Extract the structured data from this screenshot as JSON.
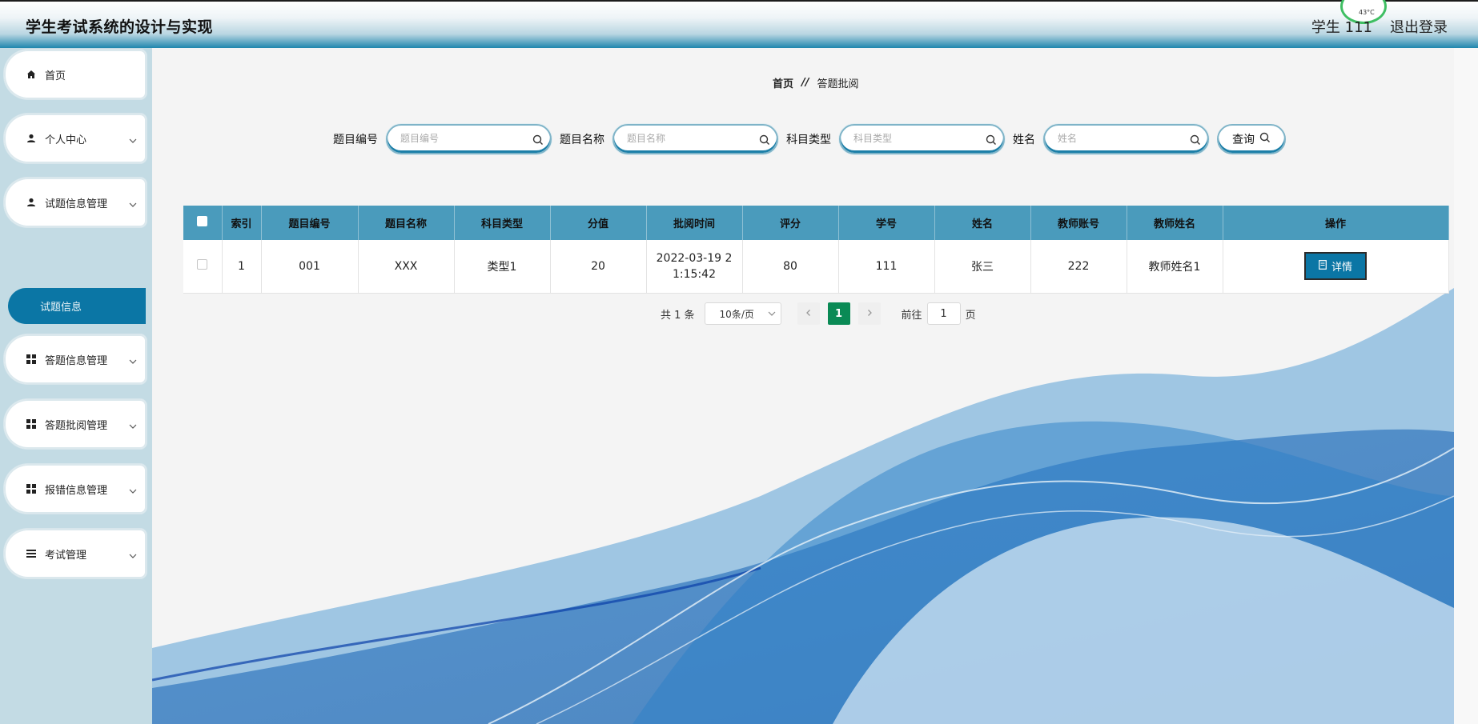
{
  "header": {
    "app_title": "学生考试系统的设计与实现",
    "user_label": "学生 111",
    "logout_label": "退出登录",
    "temp_badge": "43°C"
  },
  "sidebar": {
    "items": [
      {
        "label": "首页",
        "icon": "home-icon",
        "has_chevron": false
      },
      {
        "label": "个人中心",
        "icon": "user-icon",
        "has_chevron": true
      },
      {
        "label": "试题信息管理",
        "icon": "user-icon",
        "has_chevron": true
      },
      {
        "label": "答题信息管理",
        "icon": "grid-icon",
        "has_chevron": true
      },
      {
        "label": "答题批阅管理",
        "icon": "grid-icon",
        "has_chevron": true
      },
      {
        "label": "报错信息管理",
        "icon": "grid-icon",
        "has_chevron": true
      },
      {
        "label": "考试管理",
        "icon": "list-icon",
        "has_chevron": true
      }
    ],
    "active_sub_item": "试题信息"
  },
  "breadcrumb": {
    "home": "首页",
    "separator": "//",
    "current": "答题批阅"
  },
  "search": {
    "fields": [
      {
        "label": "题目编号",
        "placeholder": "题目编号",
        "value": ""
      },
      {
        "label": "题目名称",
        "placeholder": "题目名称",
        "value": ""
      },
      {
        "label": "科目类型",
        "placeholder": "科目类型",
        "value": ""
      },
      {
        "label": "姓名",
        "placeholder": "姓名",
        "value": ""
      }
    ],
    "query_label": "查询"
  },
  "table": {
    "headers": [
      "索引",
      "题目编号",
      "题目名称",
      "科目类型",
      "分值",
      "批阅时间",
      "评分",
      "学号",
      "姓名",
      "教师账号",
      "教师姓名",
      "操作"
    ],
    "rows": [
      {
        "index": "1",
        "code": "001",
        "name": "XXX",
        "type": "类型1",
        "score_value": "20",
        "review_time": "2022-03-19 21:15:42",
        "rating": "80",
        "student_no": "111",
        "student_name": "张三",
        "teacher_account": "222",
        "teacher_name": "教师姓名1",
        "action_label": "详情"
      }
    ]
  },
  "pagination": {
    "total_text": "共 1 条",
    "page_size": "10条/页",
    "current_page": "1",
    "goto_label": "前往",
    "goto_value": "1",
    "page_suffix": "页"
  },
  "colors": {
    "accent": "#0b76a5",
    "header_bar": "#1f86ad",
    "sidebar_bg": "#c3dbe4",
    "table_header": "#4a9bbc",
    "page_active": "#0a8a55"
  }
}
